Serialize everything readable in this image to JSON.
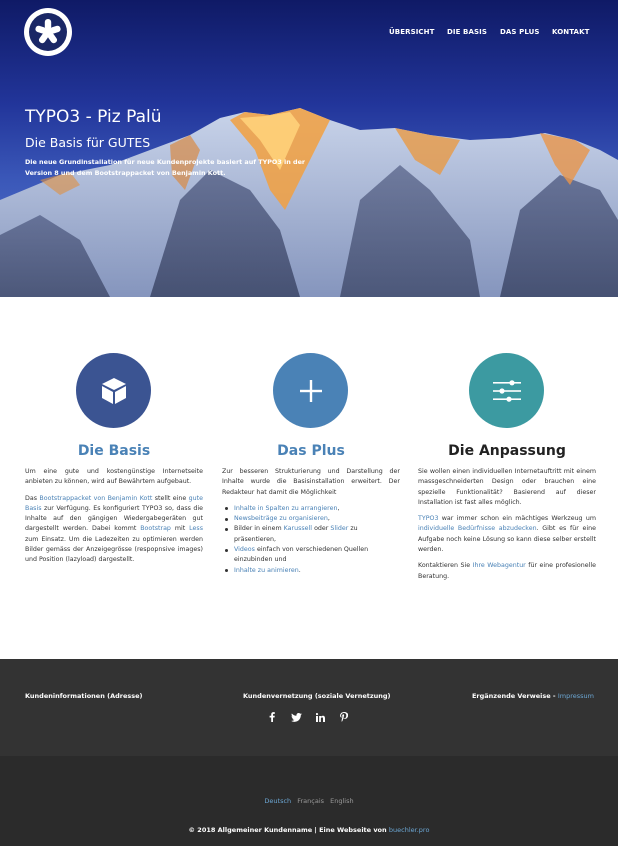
{
  "nav": {
    "items": [
      "ÜBERSICHT",
      "DIE BASIS",
      "DAS PLUS",
      "KONTAKT"
    ]
  },
  "hero": {
    "title": "TYPO3 - Piz Palü",
    "subtitle": "Die Basis für GUTES",
    "text": "Die neue Grundinstallation für neue Kundenprojekte basiert auf TYPO3 in der Version 8 und dem Bootstrappacket von Benjamin Kott."
  },
  "features": [
    {
      "title": "Die Basis",
      "icon": "cube-icon",
      "p1": "Um eine gute und kostengünstige Internetseite anbieten zu können, wird auf Bewährtem aufgebaut.",
      "p2_a": "Das ",
      "p2_link1": "Bootstrappacket von Benjamin Kott",
      "p2_b": " stellt eine ",
      "p2_link2": "gute Basis",
      "p2_c": " zur Verfügung. Es konfiguriert TYPO3 so, dass die Inhalte auf den gängigen Wiedergabegeräten gut dargestellt werden. Dabei kommt ",
      "p2_link3": "Bootstrap",
      "p2_d": " mit ",
      "p2_link4": "Less",
      "p2_e": " zum Einsatz. Um die Ladezeiten zu optimieren werden Bilder gemäss der Anzeigegrösse (respopnsive images) und Position (lazyload) dargestellt."
    },
    {
      "title": "Das Plus",
      "icon": "plus-icon",
      "p1": "Zur besseren Strukturierung und Darstellung der Inhalte wurde die Basisinstallation erweitert. Der Redakteur hat damit die Möglichkeit",
      "li1_link": "Inhalte in Spalten zu arrangieren",
      "li1_rest": ",",
      "li2_link": "Newsbeiträge zu organisieren",
      "li2_rest": ",",
      "li3_a": "Bilder in einem ",
      "li3_link1": "Karussell",
      "li3_b": " oder ",
      "li3_link2": "Slider",
      "li3_c": " zu präsentieren,",
      "li4_link": "Videos",
      "li4_rest": " einfach von verschiedenen Quellen einzubinden und",
      "li5_link": "Inhalte zu animieren",
      "li5_rest": "."
    },
    {
      "title": "Die Anpassung",
      "icon": "sliders-icon",
      "p1": "Sie wollen einen individuellen Internetauftritt mit einem massgeschneiderten Design oder brauchen eine spezielle Funktionalität? Basierend auf dieser Installation ist fast alles möglich.",
      "p2_link1": "TYPO3",
      "p2_a": " war immer schon ein mächtiges Werkzeug um ",
      "p2_link2": "individuelle Bedürfnisse abzudecken",
      "p2_b": ". Gibt es für eine Aufgabe noch keine Lösung so kann diese selber erstellt werden.",
      "p3_a": "Kontaktieren Sie ",
      "p3_link": "Ihre Webagentur",
      "p3_b": " für eine profesionelle Beratung."
    }
  ],
  "footer": {
    "left": "Kundeninformationen (Adresse)",
    "middle": "Kundenvernetzung (soziale Vernetzung)",
    "right_label": "Ergänzende Verweise - ",
    "right_link": "Impressum",
    "social": [
      "facebook-icon",
      "twitter-icon",
      "linkedin-icon",
      "pinterest-icon"
    ],
    "languages": [
      "Deutsch",
      "Français",
      "English"
    ],
    "active_language": "Deutsch",
    "copyright_text": "© 2018 Allgemeiner Kundenname | Eine Webseite von ",
    "copyright_link": "buechler.pro"
  },
  "colors": {
    "accent": "#4a82b6",
    "basis_circle": "#3b5492",
    "plus_circle": "#4a82b6",
    "anpassung_circle": "#3c9aa1",
    "footer_top": "#333333",
    "footer_bottom": "#2b2b2b"
  }
}
